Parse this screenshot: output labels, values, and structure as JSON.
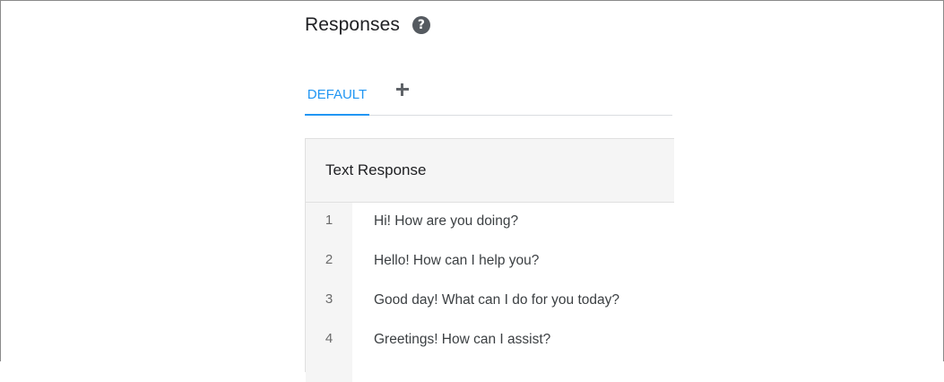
{
  "section": {
    "title": "Responses",
    "help_icon": "question-circle-icon"
  },
  "tabs": {
    "default_label": "DEFAULT",
    "add_icon": "plus-icon",
    "accent_color": "#2196f3"
  },
  "text_response": {
    "header": "Text Response",
    "rows": [
      {
        "num": "1",
        "text": "Hi! How are you doing?"
      },
      {
        "num": "2",
        "text": "Hello! How can I help you?"
      },
      {
        "num": "3",
        "text": "Good day! What can I do for you today?"
      },
      {
        "num": "4",
        "text": "Greetings! How can I assist?"
      }
    ]
  }
}
